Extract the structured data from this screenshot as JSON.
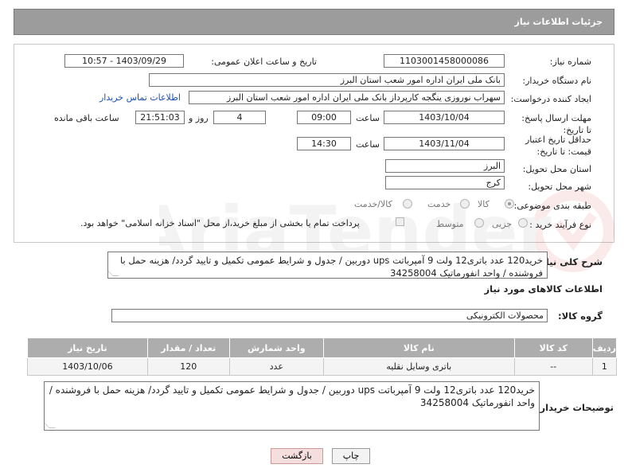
{
  "header": {
    "title": "جزئیات اطلاعات نیاز"
  },
  "labels": {
    "need_number": "شماره نیاز:",
    "announce_datetime": "تاریخ و ساعت اعلان عمومی:",
    "buyer_org": "نام دستگاه خریدار:",
    "requester": "ایجاد کننده درخواست:",
    "contact_link": "اطلاعات تماس خریدار",
    "reply_deadline": "مهلت ارسال پاسخ: تا تاریخ:",
    "price_validity": "حداقل تاریخ اعتبار قیمت: تا تاریخ:",
    "time_word": "ساعت",
    "day_and": "روز و",
    "hours_remaining": "ساعت باقی مانده",
    "province": "استان محل تحویل:",
    "city": "شهر محل تحویل:",
    "category": "طبقه بندی موضوعی:",
    "purchase_type": "نوع فرآیند خرید :",
    "general_desc": "شرح کلی نیاز:",
    "goods_info": "اطلاعات کالاهای مورد نیاز",
    "goods_group": "گروه کالا:",
    "buyer_notes": "توضیحات خریدار:"
  },
  "values": {
    "need_number": "1103001458000086",
    "announce_datetime": "1403/09/29 - 10:57",
    "buyer_org": "بانک ملی ایران اداره امور شعب استان البرز",
    "requester": "سهراب نوروزی ینگجه کارپرداز بانک ملی ایران اداره امور شعب استان البرز",
    "reply_date": "1403/10/04",
    "reply_time": "09:00",
    "days_left": "4",
    "time_left": "21:51:03",
    "validity_date": "1403/11/04",
    "validity_time": "14:30",
    "province": "البرز",
    "city": "کرج",
    "goods_group": "محصولات الکترونیکی"
  },
  "category_options": [
    "کالا",
    "خدمت",
    "کالا/خدمت"
  ],
  "category_selected": "کالا",
  "purchase_options": [
    "جزیی",
    "متوسط"
  ],
  "payment_note": "پرداخت تمام یا بخشی از مبلغ خرید،از محل \"اسناد خزانه اسلامی\" خواهد بود.",
  "general_desc": "خرید120 عدد باتری12 ولت 9 آمپرباتت ups دوربین / جدول و شرایط عمومی تکمیل و تایید گردد/ هزینه حمل با فروشنده / واحد انفورماتیک 34258004",
  "table": {
    "headers": [
      "ردیف",
      "کد کالا",
      "نام کالا",
      "واحد شمارش",
      "تعداد / مقدار",
      "تاریخ نیاز"
    ],
    "rows": [
      [
        "1",
        "--",
        "باتری وسایل نقلیه",
        "عدد",
        "120",
        "1403/10/06"
      ]
    ]
  },
  "buyer_notes": "خرید120 عدد باتری12 ولت 9 آمپرباتت ups دوربین / جدول و شرایط عمومی تکمیل و تایید گردد/ هزینه حمل با فروشنده / واحد انفورماتیک 34258004",
  "buttons": {
    "print": "چاپ",
    "back": "بازگشت"
  },
  "colors": {
    "header_bg": "#9c9c9c",
    "table_header_bg": "#adadad",
    "link": "#1a4fb5",
    "back_button_bg": "#f5dede"
  }
}
